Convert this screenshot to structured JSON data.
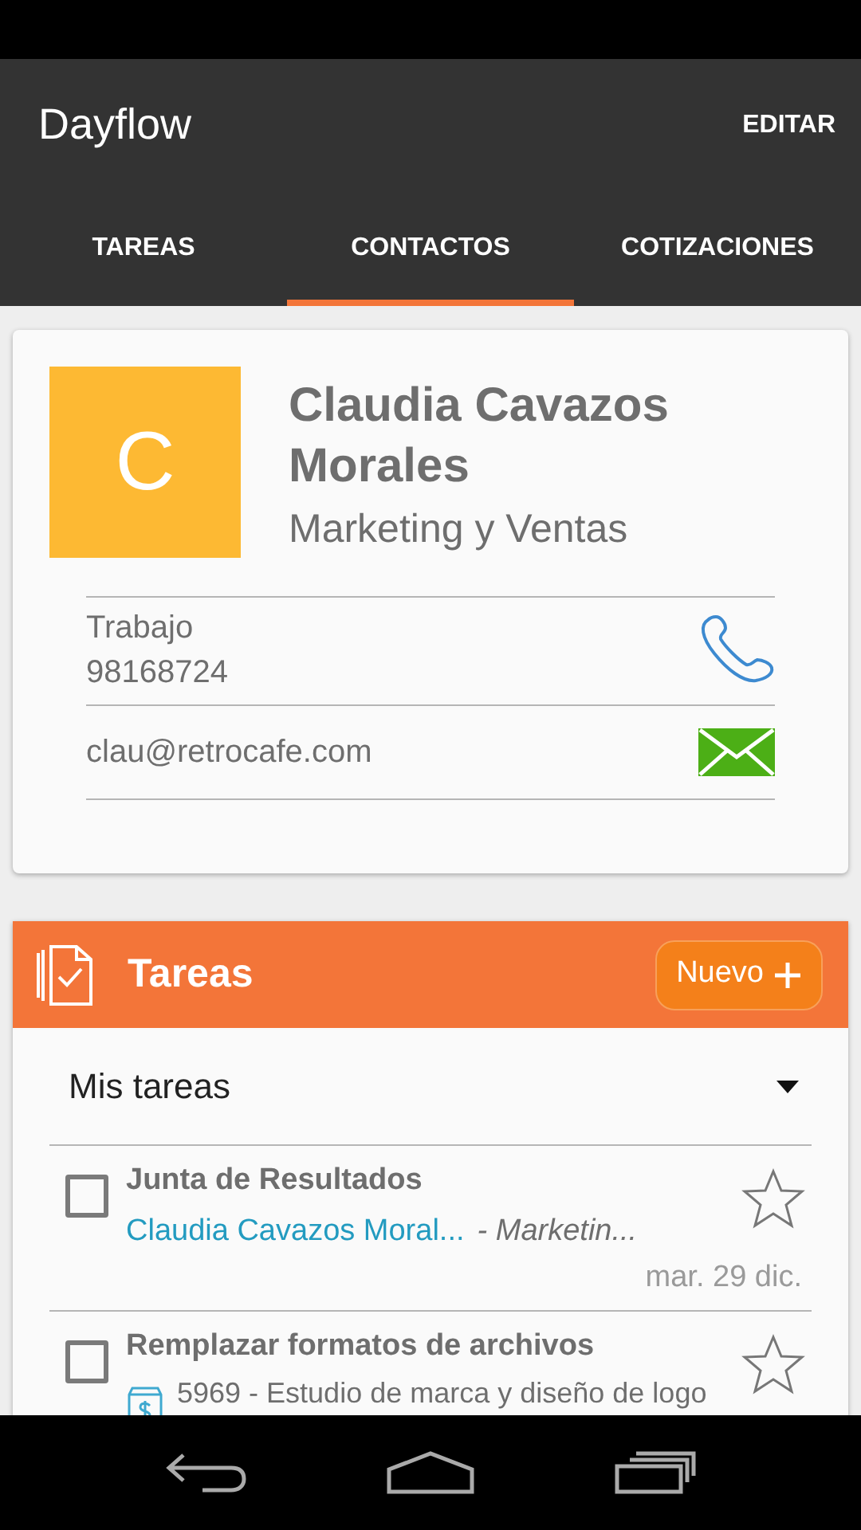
{
  "app_bar": {
    "title": "Dayflow",
    "action": "EDITAR"
  },
  "tabs": [
    {
      "label": "TAREAS",
      "selected": false
    },
    {
      "label": "CONTACTOS",
      "selected": true
    },
    {
      "label": "COTIZACIONES",
      "selected": false
    }
  ],
  "contact": {
    "avatar_letter": "C",
    "name": "Claudia Cavazos Morales",
    "department": "Marketing y Ventas",
    "phone": {
      "label": "Trabajo",
      "number": "98168724"
    },
    "email": "clau@retrocafe.com"
  },
  "tasks_panel": {
    "title": "Tareas",
    "new_button": "Nuevo",
    "filter": "Mis tareas",
    "tasks": [
      {
        "title": "Junta de Resultados",
        "checked": false,
        "starred": false,
        "contact": "Claudia Cavazos Moral...",
        "company": "- Marketin...",
        "date": "mar. 29 dic."
      },
      {
        "title": "Remplazar formatos de archivos",
        "checked": false,
        "starred": false,
        "quote": "5969 - Estudio de marca y diseño de logo"
      }
    ]
  }
}
